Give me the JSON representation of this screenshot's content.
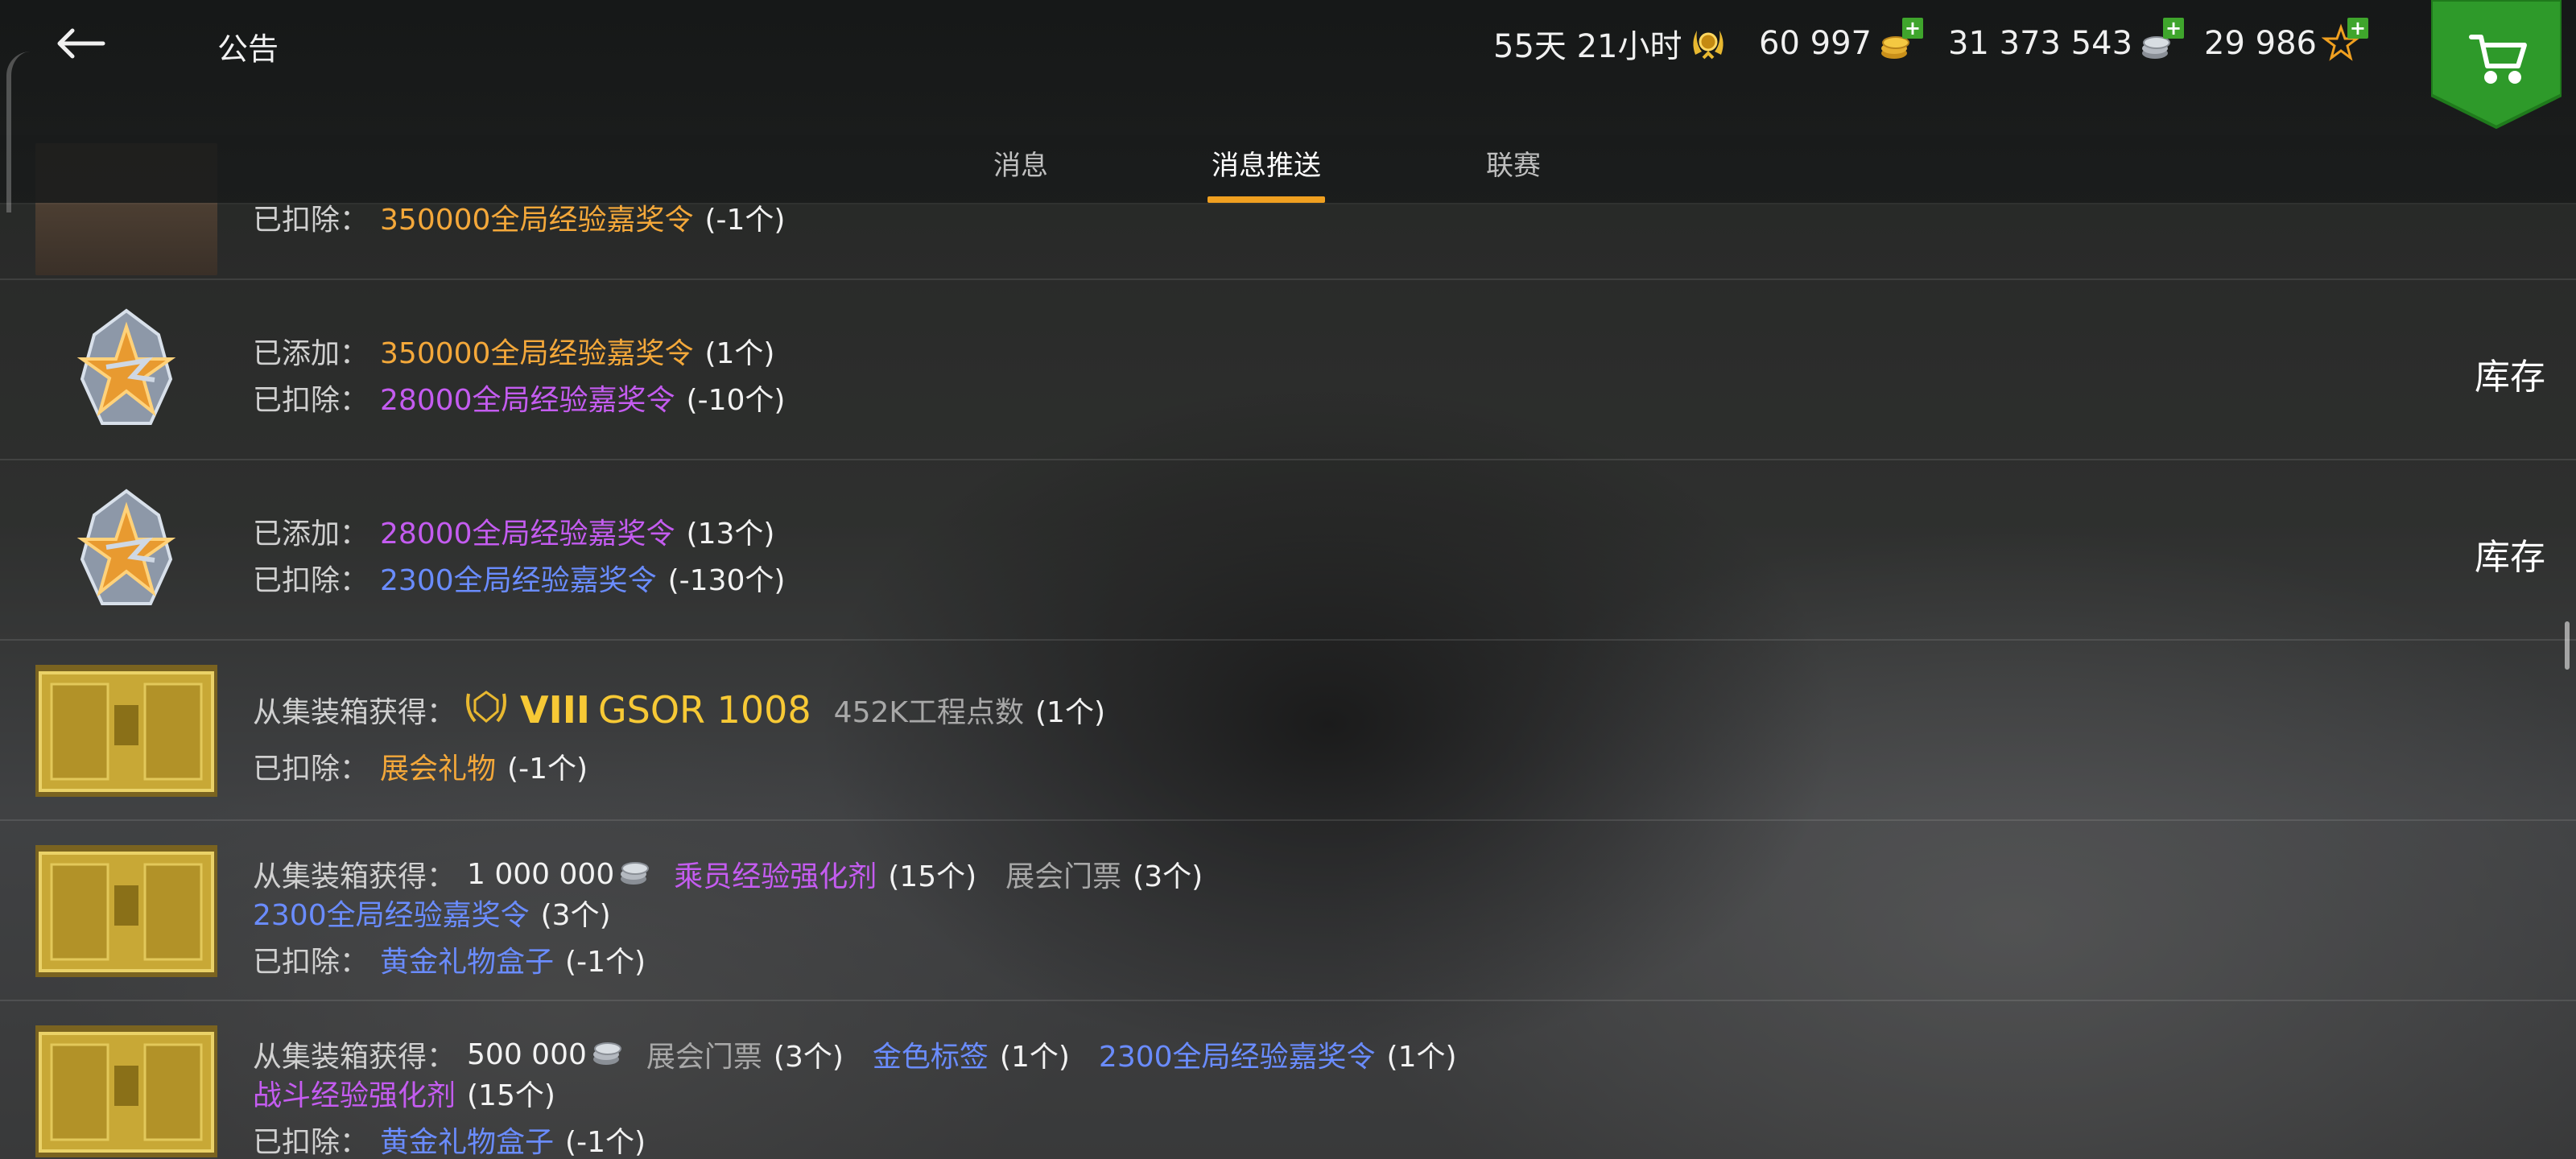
{
  "header": {
    "title": "公告",
    "currencies": [
      {
        "value": "55天 21小时",
        "icon": "premium-laurel-icon",
        "has_plus": false
      },
      {
        "value": "60 997",
        "icon": "gold-coins-icon",
        "has_plus": true
      },
      {
        "value": "31 373 543",
        "icon": "silver-coins-icon",
        "has_plus": true
      },
      {
        "value": "29 986",
        "icon": "free-xp-star-icon",
        "has_plus": true
      }
    ]
  },
  "tabs": [
    {
      "label": "消息",
      "active": false
    },
    {
      "label": "消息推送",
      "active": true
    },
    {
      "label": "联赛",
      "active": false
    }
  ],
  "rows": [
    {
      "lines": [
        [
          {
            "t": "已扣除：",
            "c": "lbl"
          },
          {
            "t": "350000全局经验嘉奖令",
            "c": "orange"
          },
          {
            "t": "(-1个)",
            "c": "white"
          }
        ]
      ],
      "action": ""
    },
    {
      "lines": [
        [
          {
            "t": "已添加：",
            "c": "lbl"
          },
          {
            "t": "350000全局经验嘉奖令",
            "c": "orange"
          },
          {
            "t": "(1个)",
            "c": "white"
          }
        ],
        [
          {
            "t": "已扣除：",
            "c": "lbl"
          },
          {
            "t": "28000全局经验嘉奖令",
            "c": "purple"
          },
          {
            "t": "(-10个)",
            "c": "white"
          }
        ]
      ],
      "action": "库存"
    },
    {
      "lines": [
        [
          {
            "t": "已添加：",
            "c": "lbl"
          },
          {
            "t": "28000全局经验嘉奖令",
            "c": "purple"
          },
          {
            "t": "(13个)",
            "c": "white"
          }
        ],
        [
          {
            "t": "已扣除：",
            "c": "lbl"
          },
          {
            "t": "2300全局经验嘉奖令",
            "c": "blue"
          },
          {
            "t": "(-130个)",
            "c": "white"
          }
        ]
      ],
      "action": "库存"
    },
    {
      "lines": [
        [
          {
            "t": "从集装箱获得：",
            "c": "lbl"
          },
          {
            "t": "VIII",
            "c": "gold"
          },
          {
            "t": "GSOR 1008",
            "c": "gold"
          },
          {
            "t": "452K工程点数",
            "c": "grey"
          },
          {
            "t": "(1个)",
            "c": "white"
          }
        ],
        [
          {
            "t": "已扣除：",
            "c": "lbl"
          },
          {
            "t": "展会礼物",
            "c": "orange"
          },
          {
            "t": "(-1个)",
            "c": "white"
          }
        ]
      ],
      "action": ""
    },
    {
      "lines": [
        [
          {
            "t": "从集装箱获得：",
            "c": "lbl"
          },
          {
            "t": "1 000 000",
            "c": "white"
          },
          {
            "t": "乘员经验强化剂",
            "c": "purple"
          },
          {
            "t": "(15个)",
            "c": "white"
          },
          {
            "t": "展会门票",
            "c": "grey"
          },
          {
            "t": "(3个)",
            "c": "white"
          }
        ],
        [
          {
            "t": "2300全局经验嘉奖令",
            "c": "blue"
          },
          {
            "t": "(3个)",
            "c": "white"
          }
        ],
        [
          {
            "t": "已扣除：",
            "c": "lbl"
          },
          {
            "t": "黄金礼物盒子",
            "c": "blue"
          },
          {
            "t": "(-1个)",
            "c": "white"
          }
        ]
      ],
      "action": ""
    },
    {
      "lines": [
        [
          {
            "t": "从集装箱获得：",
            "c": "lbl"
          },
          {
            "t": "500 000",
            "c": "white"
          },
          {
            "t": "展会门票",
            "c": "grey"
          },
          {
            "t": "(3个)",
            "c": "white"
          },
          {
            "t": "金色标签",
            "c": "blue"
          },
          {
            "t": "(1个)",
            "c": "white"
          },
          {
            "t": "2300全局经验嘉奖令",
            "c": "blue"
          },
          {
            "t": "(1个)",
            "c": "white"
          }
        ],
        [
          {
            "t": "战斗经验强化剂",
            "c": "purple"
          },
          {
            "t": "(15个)",
            "c": "white"
          }
        ],
        [
          {
            "t": "已扣除：",
            "c": "lbl"
          },
          {
            "t": "黄金礼物盒子",
            "c": "blue"
          },
          {
            "t": "(-1个)",
            "c": "white"
          }
        ]
      ],
      "action": ""
    }
  ],
  "colors": {
    "accent_tab": "#f0a020",
    "orange": "#f4a83a",
    "purple": "#c45cf0",
    "blue": "#6a8cff",
    "gold": "#f7c935",
    "plus_green": "#3fa52c",
    "cart_green": "#2e9a2a"
  }
}
